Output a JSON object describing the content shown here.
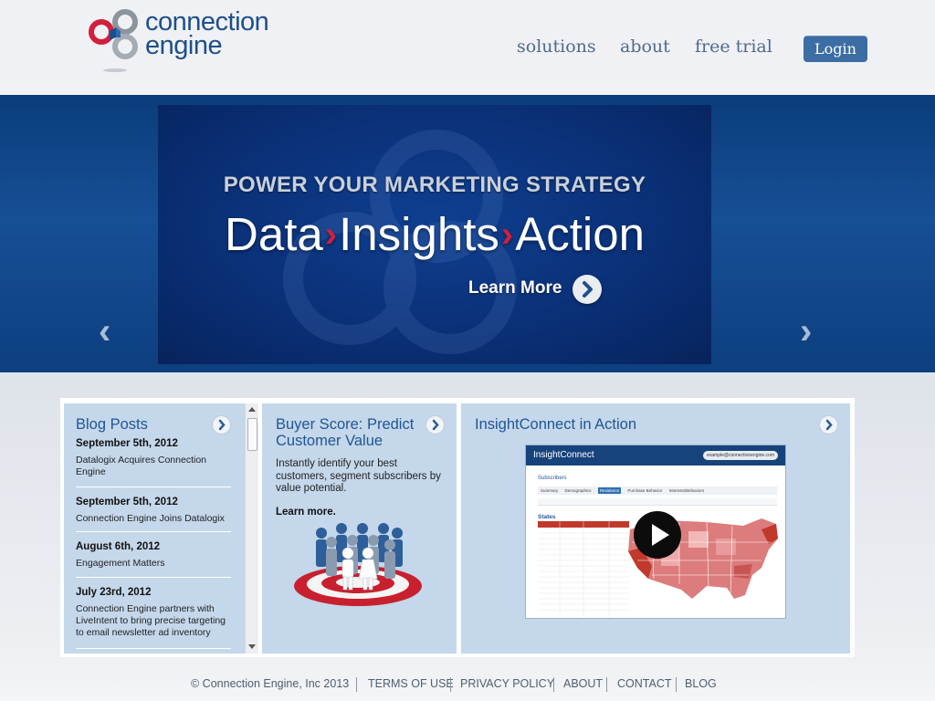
{
  "brand": {
    "name_line1": "connection",
    "name_line2": "engine",
    "colors": {
      "ring_red": "#d21f3c",
      "ring_blue": "#1d4f8a",
      "ring_gray": "#9aa3ad"
    }
  },
  "nav": {
    "items": [
      "solutions",
      "about",
      "free trial"
    ],
    "login_label": "Login"
  },
  "hero": {
    "kicker": "POWER YOUR MARKETING STRATEGY",
    "headline_words": [
      "Data",
      "Insights",
      "Action"
    ],
    "chevron_glyph": "›",
    "learn_more": "Learn More",
    "prev_glyph": "‹",
    "next_glyph": "›",
    "background_color": "#0d4389"
  },
  "blog": {
    "title": "Blog Posts",
    "posts": [
      {
        "date": "September 5th, 2012",
        "text": "Datalogix Acquires Connection Engine"
      },
      {
        "date": "September 5th, 2012",
        "text": "Connection Engine Joins Datalogix"
      },
      {
        "date": "August 6th, 2012",
        "text": "Engagement Matters"
      },
      {
        "date": "July 23rd, 2012",
        "text": "Connection Engine partners with LiveIntent to bring precise targeting to email newsletter ad inventory"
      }
    ]
  },
  "buyer": {
    "title": "Buyer Score: Predict Customer Value",
    "description": "Instantly identify your best customers, segment subscribers by value potential.",
    "learn_more": "Learn more."
  },
  "insight": {
    "title": "InsightConnect in Action",
    "screenshot": {
      "app_title": "InsightConnect",
      "email": "example@connectionengine.com",
      "section": "Subscribers",
      "table_title": "States",
      "tabs": [
        "Summary",
        "Demographics",
        "Residence",
        "Purchase Behavior",
        "Interests/Behaviors"
      ]
    }
  },
  "footer": {
    "copyright": "© Connection Engine, Inc 2013",
    "links": [
      "TERMS OF USE",
      "PRIVACY POLICY",
      "ABOUT",
      "CONTACT",
      "BLOG"
    ]
  }
}
